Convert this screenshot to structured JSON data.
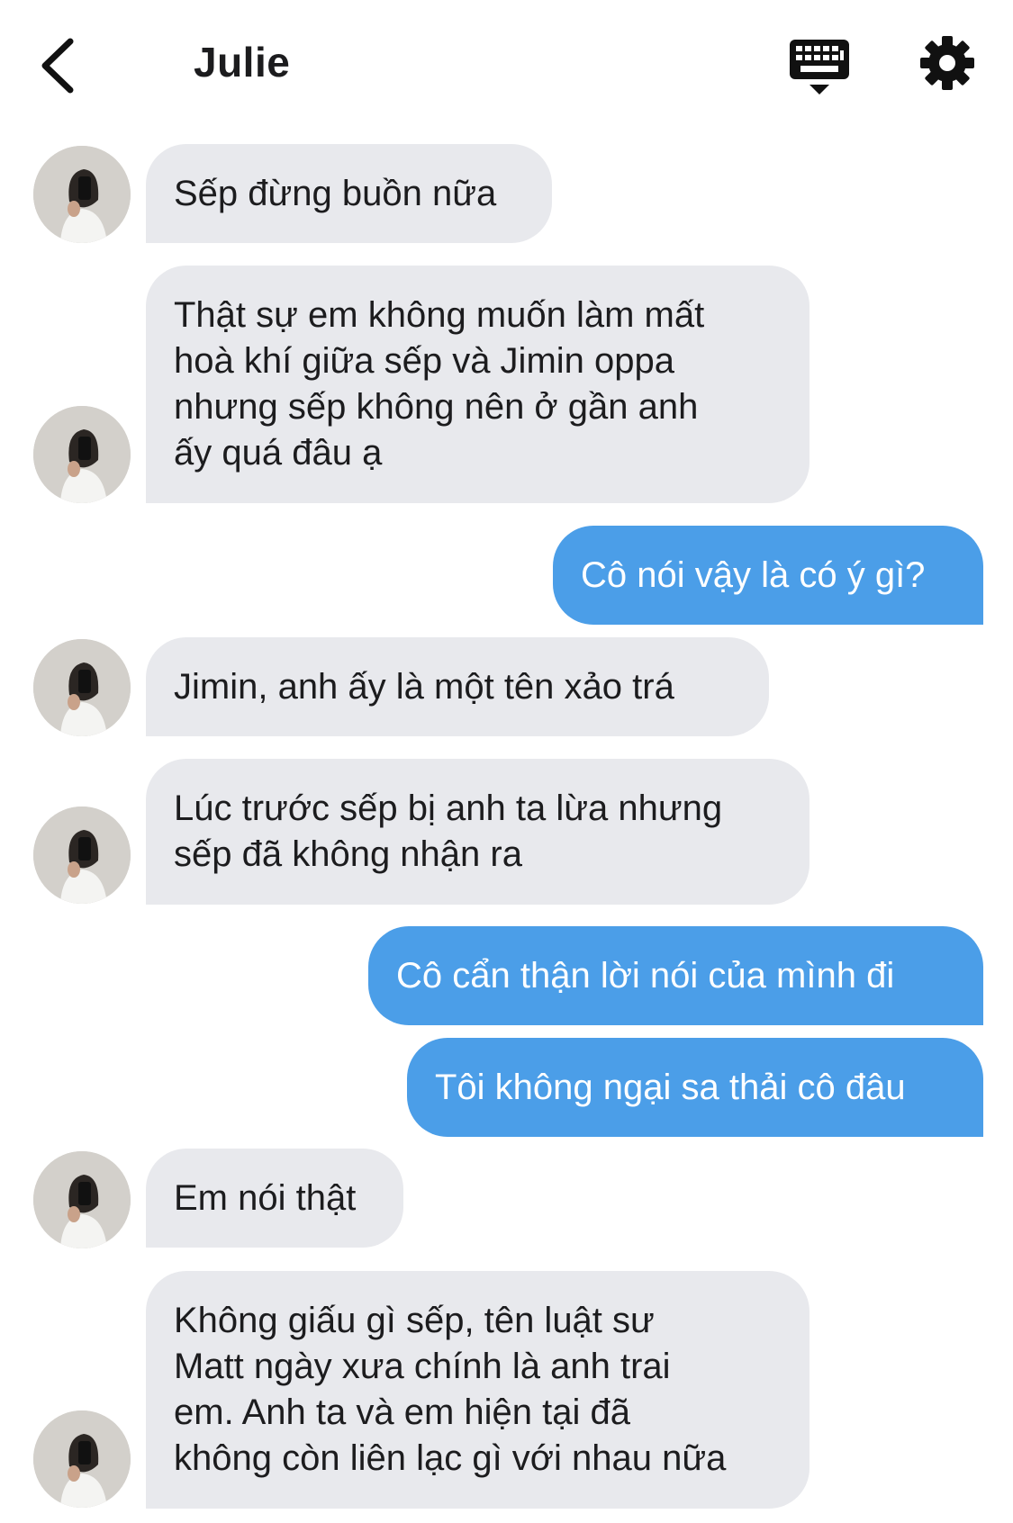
{
  "header": {
    "contact_name": "Julie",
    "back_icon": "chevron-left-icon",
    "keyboard_icon": "keyboard-icon",
    "settings_icon": "gear-icon"
  },
  "colors": {
    "incoming_bubble": "#e8e9ed",
    "outgoing_bubble": "#4b9ee8",
    "text_dark": "#1c1c1e"
  },
  "messages": [
    {
      "sender": "Julie",
      "text": "Sếp đừng buồn nữa"
    },
    {
      "sender": "Julie",
      "text": "Thật sự em không muốn làm mất\nhoà khí giữa sếp và Jimin oppa\nnhưng sếp không nên ở gần anh\nấy quá đâu ạ"
    },
    {
      "sender": "me",
      "text": "Cô nói vậy là có ý gì?"
    },
    {
      "sender": "Julie",
      "text": "Jimin, anh ấy là một tên xảo trá"
    },
    {
      "sender": "Julie",
      "text": "Lúc trước sếp bị anh ta lừa nhưng\nsếp đã không nhận ra"
    },
    {
      "sender": "me",
      "text": "Cô cẩn thận lời nói của mình đi"
    },
    {
      "sender": "me",
      "text": "Tôi không ngại sa thải cô đâu"
    },
    {
      "sender": "Julie",
      "text": "Em nói thật"
    },
    {
      "sender": "Julie",
      "text": "Không giấu gì sếp, tên luật sư\nMatt ngày xưa chính là anh trai\nem. Anh ta và em hiện tại đã\nkhông còn liên lạc gì với nhau nữa"
    }
  ]
}
